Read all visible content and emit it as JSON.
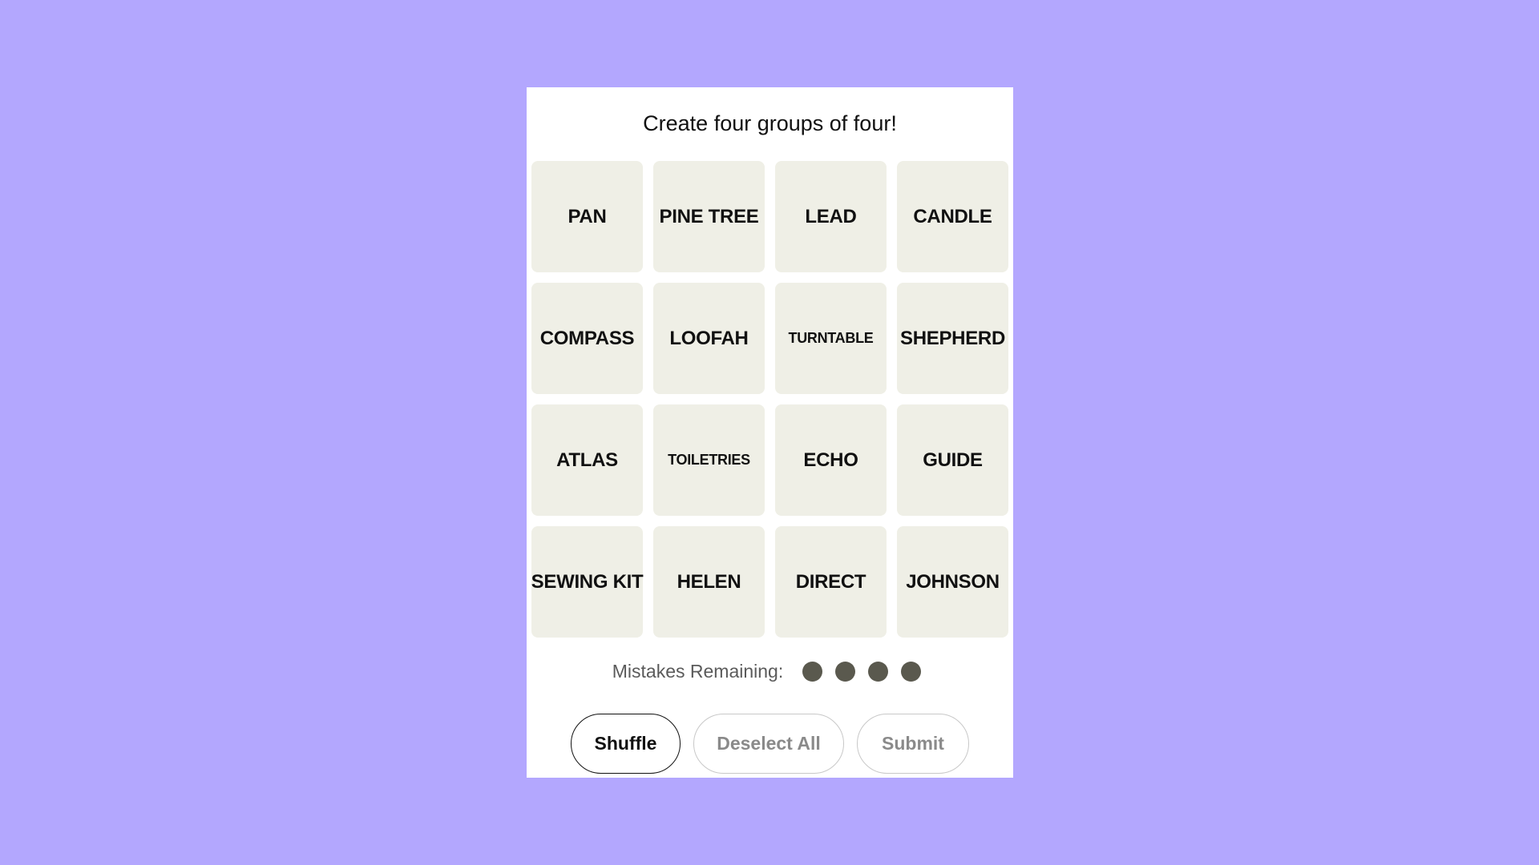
{
  "game": {
    "title": "Create four groups of four!",
    "tiles": [
      {
        "label": "PAN",
        "size": "normal"
      },
      {
        "label": "PINE TREE",
        "size": "normal"
      },
      {
        "label": "LEAD",
        "size": "normal"
      },
      {
        "label": "CANDLE",
        "size": "normal"
      },
      {
        "label": "COMPASS",
        "size": "normal"
      },
      {
        "label": "LOOFAH",
        "size": "normal"
      },
      {
        "label": "TURNTABLE",
        "size": "small"
      },
      {
        "label": "SHEPHERD",
        "size": "normal"
      },
      {
        "label": "ATLAS",
        "size": "normal"
      },
      {
        "label": "TOILETRIES",
        "size": "small"
      },
      {
        "label": "ECHO",
        "size": "normal"
      },
      {
        "label": "GUIDE",
        "size": "normal"
      },
      {
        "label": "SEWING KIT",
        "size": "normal"
      },
      {
        "label": "HELEN",
        "size": "normal"
      },
      {
        "label": "DIRECT",
        "size": "normal"
      },
      {
        "label": "JOHNSON",
        "size": "normal"
      }
    ],
    "mistakes": {
      "label": "Mistakes Remaining:",
      "remaining": 4,
      "dot_color": "#5a594e"
    },
    "buttons": {
      "shuffle": "Shuffle",
      "deselect_all": "Deselect All",
      "submit": "Submit"
    }
  },
  "colors": {
    "background": "#b3a7fe",
    "tile": "#efefe6"
  }
}
